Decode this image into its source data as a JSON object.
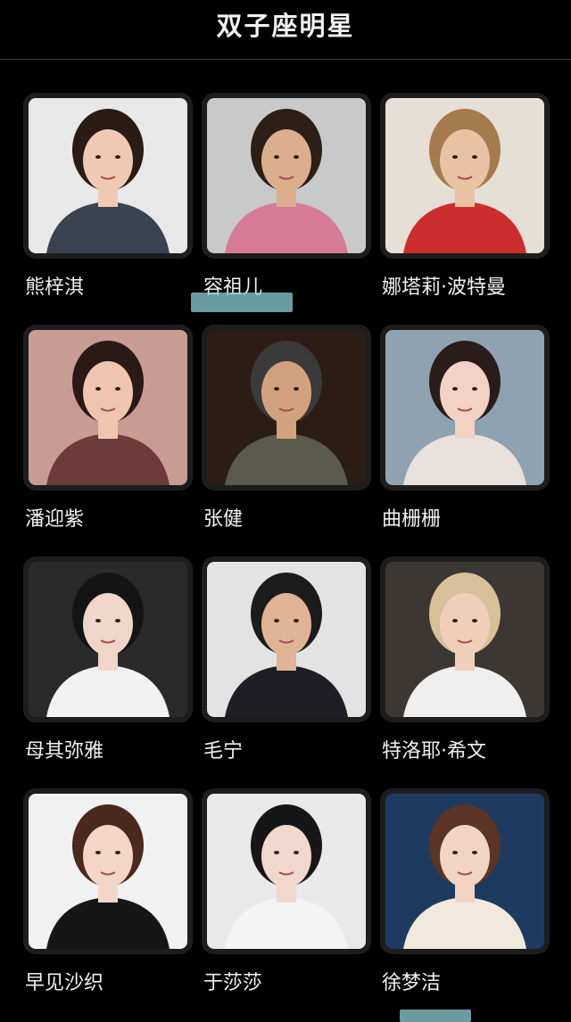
{
  "header": {
    "title": "双子座明星"
  },
  "celebrities": [
    {
      "name": "熊梓淇",
      "photo_icon": "portrait-photo",
      "bg": "#e8e8e8",
      "hair": "#2a1c14",
      "skin": "#efc9b4",
      "cloth": "#3a4350"
    },
    {
      "name": "容祖儿",
      "photo_icon": "portrait-photo",
      "bg": "#c9c9c9",
      "hair": "#2b1f17",
      "skin": "#dcae8e",
      "cloth": "#d77a98"
    },
    {
      "name": "娜塔莉·波特曼",
      "photo_icon": "portrait-photo",
      "bg": "#e6dfd6",
      "hair": "#a57a4c",
      "skin": "#e8c2a2",
      "cloth": "#cc2e2e"
    },
    {
      "name": "潘迎紫",
      "photo_icon": "portrait-photo",
      "bg": "#c99c93",
      "hair": "#2a1a15",
      "skin": "#f0c4b0",
      "cloth": "#6e3a3a"
    },
    {
      "name": "张健",
      "photo_icon": "portrait-photo",
      "bg": "#2b1d15",
      "hair": "#3a3a3a",
      "skin": "#d2a27e",
      "cloth": "#5a5a4e"
    },
    {
      "name": "曲栅栅",
      "photo_icon": "portrait-photo",
      "bg": "#8ea2b2",
      "hair": "#2a1c18",
      "skin": "#f1d2c4",
      "cloth": "#e8e1dc"
    },
    {
      "name": "母其弥雅",
      "photo_icon": "portrait-photo",
      "bg": "#2a2a2a",
      "hair": "#141414",
      "skin": "#efd6c8",
      "cloth": "#f2f2f2"
    },
    {
      "name": "毛宁",
      "photo_icon": "portrait-photo",
      "bg": "#e3e3e3",
      "hair": "#1c1c1c",
      "skin": "#e0b394",
      "cloth": "#1e1e24"
    },
    {
      "name": "特洛耶·希文",
      "photo_icon": "portrait-photo",
      "bg": "#3c3733",
      "hair": "#d8c09a",
      "skin": "#efcfba",
      "cloth": "#efefef"
    },
    {
      "name": "早见沙织",
      "photo_icon": "portrait-photo",
      "bg": "#f1f1f1",
      "hair": "#4a2a1e",
      "skin": "#f3d6c6",
      "cloth": "#161616"
    },
    {
      "name": "于莎莎",
      "photo_icon": "portrait-photo",
      "bg": "#e9e9e9",
      "hair": "#161616",
      "skin": "#f2d8cc",
      "cloth": "#f4f4f4"
    },
    {
      "name": "徐梦洁",
      "photo_icon": "portrait-photo",
      "bg": "#1f3a60",
      "hair": "#5a3424",
      "skin": "#f2d4c2",
      "cloth": "#f1e8de"
    }
  ]
}
